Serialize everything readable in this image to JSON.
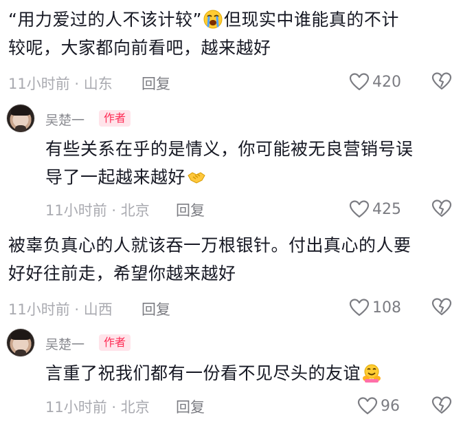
{
  "comments": [
    {
      "text_line1": "“用力爱过的人不该计较”",
      "emoji1": "crying-face-icon",
      "text_line1b": "但现实中谁能真的不计",
      "text_line2": "较呢，大家都向前看吧，越来越好",
      "meta": "11小时前 · 山东",
      "reply": "回复",
      "likes": "420"
    },
    {
      "author": "吴楚一",
      "badge": "作者",
      "text_line1": "有些关系在乎的是情义，你可能被无良营销号误",
      "text_line2": "导了一起越来越好",
      "emoji": "handshake-icon",
      "meta": "11小时前 · 北京",
      "reply": "回复",
      "likes": "425"
    },
    {
      "text_line1": "被辜负真心的人就该吞一万根银针。付出真心的人要",
      "text_line2": "好好往前走，希望你越来越好",
      "meta": "11小时前 · 山西",
      "reply": "回复",
      "likes": "108"
    },
    {
      "author": "吴楚一",
      "badge": "作者",
      "text_line1": "言重了祝我们都有一份看不见尽头的友谊",
      "emoji": "hugging-face-icon",
      "meta": "11小时前 · 北京",
      "reply": "回复",
      "likes": "96"
    }
  ],
  "colors": {
    "text": "#161823",
    "meta": "#a9aab0",
    "badge_text": "#fe2c55",
    "badge_bg": "#ffe4ea"
  }
}
